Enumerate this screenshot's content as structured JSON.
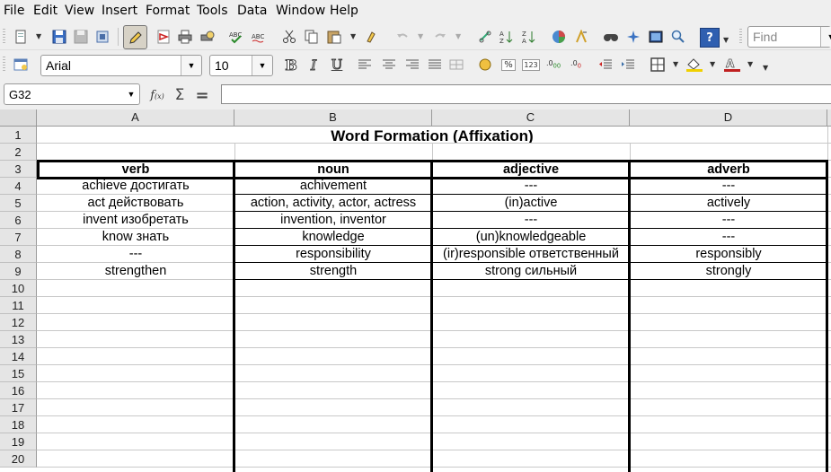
{
  "menu": [
    "File",
    "Edit",
    "View",
    "Insert",
    "Format",
    "Tools",
    "Data",
    "Window",
    "Help"
  ],
  "toolbar": {
    "find_placeholder": "Find",
    "font_name": "Arial",
    "font_size": "10"
  },
  "formula": {
    "name_box": "G32",
    "content": ""
  },
  "columns": [
    "A",
    "B",
    "C",
    "D"
  ],
  "rows": [
    "1",
    "2",
    "3",
    "4",
    "5",
    "6",
    "7",
    "8",
    "9",
    "10",
    "11",
    "12",
    "13",
    "14",
    "15",
    "16",
    "17",
    "18",
    "19",
    "20"
  ],
  "sheet": {
    "title": "Word Formation (Affixation)",
    "headers": [
      "verb",
      "noun",
      "adjective",
      "adverb"
    ],
    "data": [
      [
        "achieve достигать",
        "achivement",
        "---",
        "---"
      ],
      [
        "act действовать",
        "action, activity, actor, actress",
        "(in)active",
        "actively"
      ],
      [
        "invent изобретать",
        "invention, inventor",
        "---",
        "---"
      ],
      [
        "know знать",
        "knowledge",
        "(un)knowledgeable",
        "---"
      ],
      [
        "---",
        "responsibility",
        "(ir)responsible ответственный",
        "responsibly"
      ],
      [
        "strengthen",
        "strength",
        "strong сильный",
        "strongly"
      ]
    ]
  }
}
